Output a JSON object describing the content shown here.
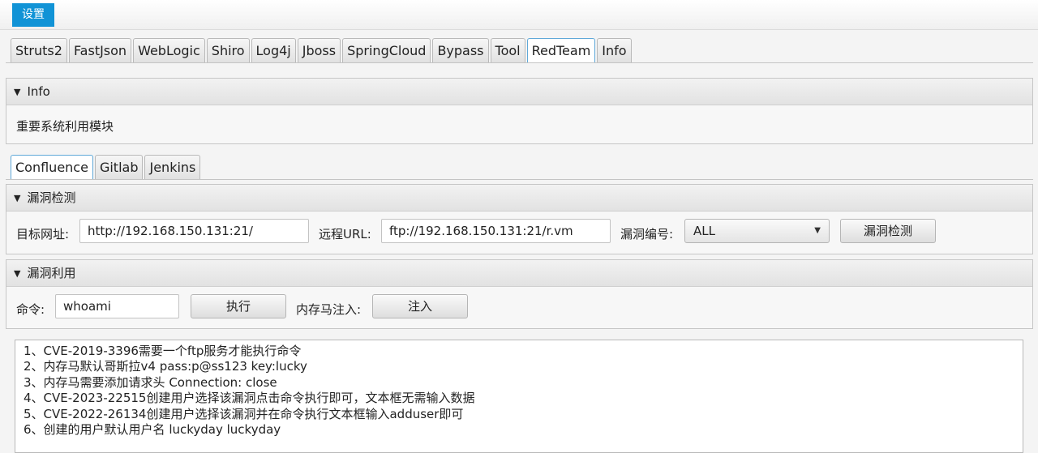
{
  "menu": {
    "settings": "设置"
  },
  "main_tabs": [
    {
      "label": "Struts2"
    },
    {
      "label": "FastJson"
    },
    {
      "label": "WebLogic"
    },
    {
      "label": "Shiro"
    },
    {
      "label": "Log4j"
    },
    {
      "label": "Jboss"
    },
    {
      "label": "SpringCloud"
    },
    {
      "label": "Bypass"
    },
    {
      "label": "Tool"
    },
    {
      "label": "RedTeam"
    },
    {
      "label": "Info"
    }
  ],
  "main_selected": "RedTeam",
  "info_section": {
    "title": "Info",
    "description": "重要系统利用模块"
  },
  "sub_tabs": [
    {
      "label": "Confluence"
    },
    {
      "label": "Gitlab"
    },
    {
      "label": "Jenkins"
    }
  ],
  "sub_selected": "Confluence",
  "detect": {
    "title": "漏洞检测",
    "target_label": "目标网址:",
    "target_value": "http://192.168.150.131:21/",
    "remote_label": "远程URL:",
    "remote_value": "ftp://192.168.150.131:21/r.vm",
    "vuln_label": "漏洞编号:",
    "vuln_value": "ALL",
    "button": "漏洞检测"
  },
  "exploit": {
    "title": "漏洞利用",
    "cmd_label": "命令:",
    "cmd_value": "whoami",
    "exec_button": "执行",
    "mem_label": "内存马注入:",
    "inject_button": "注入"
  },
  "output_lines": [
    "1、CVE-2019-3396需要一个ftp服务才能执行命令",
    "2、内存马默认哥斯拉v4 pass:p@ss123 key:lucky",
    "3、内存马需要添加请求头 Connection: close",
    "4、CVE-2023-22515创建用户选择该漏洞点击命令执行即可，文本框无需输入数据",
    "5、CVE-2022-26134创建用户选择该漏洞并在命令执行文本框输入adduser即可",
    "6、创建的用户默认用户名 luckyday luckyday"
  ]
}
